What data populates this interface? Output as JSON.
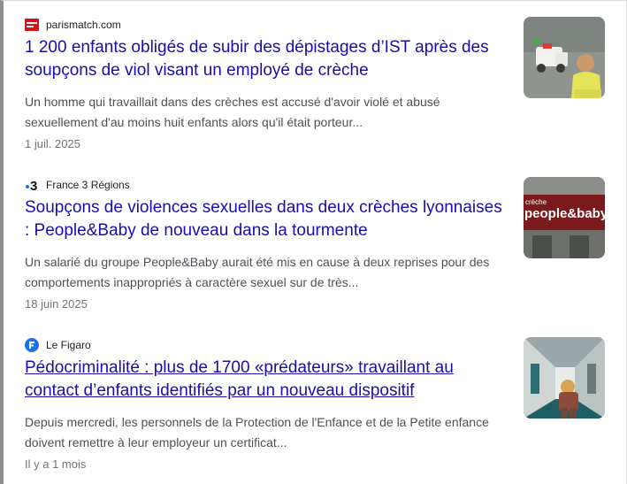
{
  "articles": [
    {
      "source_name": "parismatch.com",
      "source_icon": "parismatch-logo-icon",
      "title": "1 200 enfants obligés de subir des dépistages d’IST après des soupçons de viol visant un employé de crèche",
      "snippet": "Un homme qui travaillait dans des crèches est accusé d'avoir violé et abusé sexuellement d'au moins huit enfants alors qu'il était porteur...",
      "date": "1 juil. 2025"
    },
    {
      "source_name": "France 3 Régions",
      "source_icon": "france3-logo-icon",
      "icon_text": "3",
      "title": "Soupçons de violences sexuelles dans deux crèches lyonnaises : People&Baby de nouveau dans la tourmente",
      "snippet": "Un salarié du groupe People&Baby aurait été mis en cause à deux reprises pour des comportements inappropriés à caractère sexuel sur de très...",
      "date": "18 juin 2025",
      "thumb_sign_top": "crèche",
      "thumb_sign_main": "people&baby"
    },
    {
      "source_name": "Le Figaro",
      "source_icon": "lefigaro-logo-icon",
      "title": "Pédocriminalité : plus de 1700 «prédateurs» travaillant au contact d’enfants identifiés par un nouveau dispositif",
      "snippet": "Depuis mercredi, les personnels de la Protection de l'Enfance et de la Petite enfance doivent remettre à leur employeur un certificat...",
      "date": "Il y a 1 mois"
    }
  ],
  "colors": {
    "title_link": "#1a0dab",
    "snippet": "#4d5156",
    "meta": "#70757a",
    "parismatch_red": "#d4141b",
    "figaro_blue": "#1a73e8"
  }
}
